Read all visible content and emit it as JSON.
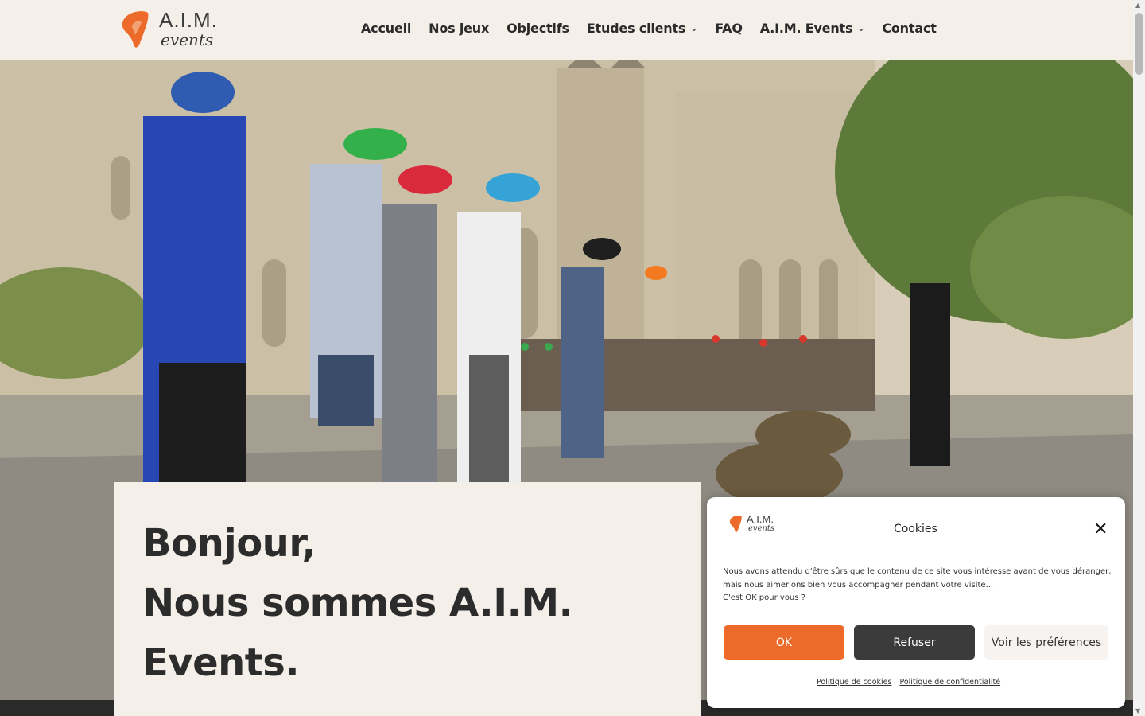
{
  "header": {
    "logo": {
      "aim": "A.I.M.",
      "events": "events"
    },
    "nav": [
      {
        "label": "Accueil",
        "dropdown": false
      },
      {
        "label": "Nos jeux",
        "dropdown": false
      },
      {
        "label": "Objectifs",
        "dropdown": false
      },
      {
        "label": "Etudes clients",
        "dropdown": true
      },
      {
        "label": "FAQ",
        "dropdown": false
      },
      {
        "label": "A.I.M. Events",
        "dropdown": true
      },
      {
        "label": "Contact",
        "dropdown": false
      }
    ]
  },
  "hero": {
    "headline_lines": [
      "Bonjour,",
      "Nous sommes A.I.M.",
      "Events."
    ]
  },
  "cookie": {
    "title": "Cookies",
    "text_lines": [
      "Nous avons attendu d'être sûrs que le contenu de ce site vous intéresse avant de vous déranger,",
      "mais nous aimerions bien vous accompagner pendant votre visite...",
      "C'est OK pour vous ?"
    ],
    "buttons": {
      "ok": "OK",
      "refuse": "Refuser",
      "prefs": "Voir les préférences"
    },
    "links": {
      "cookies_policy": "Politique de cookies",
      "privacy_policy": "Politique de confidentialité"
    }
  },
  "colors": {
    "accent": "#ec6b2a",
    "dark": "#3b3b3b",
    "header_bg": "#f4efe9"
  }
}
